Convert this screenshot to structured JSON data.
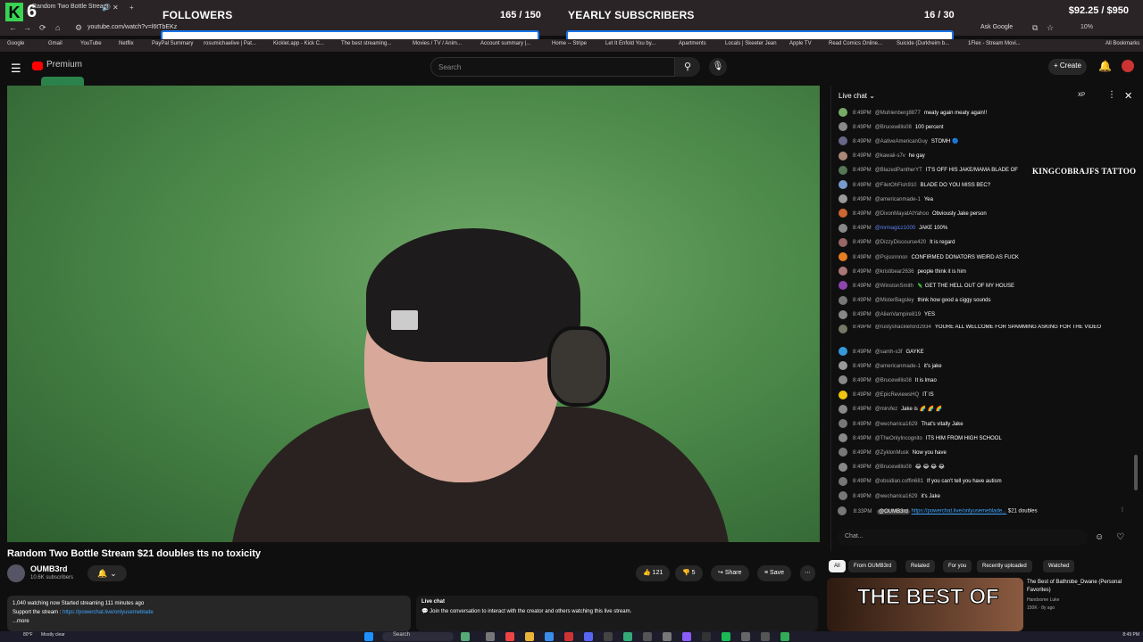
{
  "overlay": {
    "logo_letter": "K",
    "big_number": "6",
    "followers_label": "FOLLOWERS",
    "followers_count": "165 / 150",
    "subs_label": "YEARLY SUBSCRIBERS",
    "subs_count": "16 / 30",
    "money": "$92.25 / $950",
    "kingcobra_text": "KINGCOBRAJFS TATTOO"
  },
  "browser": {
    "tab_title": "Random Two Bottle Stream",
    "url": "youtube.com/watch?v=l6tTbEKz",
    "ask_google": "Ask Google",
    "zoom": "10%",
    "bookmarks": [
      "Google",
      "Gmail",
      "YouTube",
      "Netflix",
      "PayPal Summary",
      "rosumichaelive | Pat...",
      "Kicklet.app - Kick C...",
      "The best streaming...",
      "Movies / TV / Anim...",
      "Account summary |...",
      "Home -- Stripe",
      "Let It Enfold You by...",
      "Apartments",
      "Locals | Skeeter Jean",
      "Apple TV",
      "Read Comics Online...",
      "Suicide (Durkheim b...",
      "1Flex - Stream Movi...",
      "All Bookmarks"
    ]
  },
  "youtube": {
    "premium_label": "Premium",
    "search_placeholder": "Search",
    "create_label": "Create"
  },
  "video": {
    "title": "Random Two Bottle Stream $21 doubles tts no toxicity",
    "channel": "OUMB3rd",
    "subscribers": "10.6K subscribers",
    "likes": "121",
    "dislikes": "5",
    "share": "Share",
    "save": "Save",
    "watching": "1,040 watching now  Started streaming 111 minutes ago",
    "support": "Support the stream :",
    "support_link": "https://powerchat.live/onlyusemeblade",
    "more": "...more",
    "live_chat_title": "Live chat",
    "live_chat_desc": "Join the conversation to interact with the creator and others watching this live stream."
  },
  "chat": {
    "header": "Live chat",
    "xp": "XP",
    "messages": [
      {
        "time": "8:49PM",
        "author": "@Muhlenberg8877",
        "text": "meaty again meaty again!!",
        "color": "#7a6"
      },
      {
        "time": "8:49PM",
        "author": "@Brucewillis08",
        "text": "100 percent",
        "color": "#888"
      },
      {
        "time": "8:49PM",
        "author": "@AativeAmericanGuy",
        "text": "STOMH 🔵",
        "color": "#668"
      },
      {
        "time": "8:49PM",
        "author": "@kawaii-s7v",
        "text": "he gay",
        "color": "#a87"
      },
      {
        "time": "8:49PM",
        "author": "@BlazedPantherYT",
        "text": "IT'S OFF HIS JAKE/MAMA BLADE OF",
        "color": "#575"
      },
      {
        "time": "8:49PM",
        "author": "@FiletOhFish910",
        "text": "BLADE DO YOU MISS BEC?",
        "color": "#79c"
      },
      {
        "time": "8:49PM",
        "author": "@americanmade-1",
        "text": "Yea",
        "color": "#999"
      },
      {
        "time": "8:49PM",
        "author": "@DixonMayatAtYahoo",
        "text": "Obviously Jake person",
        "color": "#c63"
      },
      {
        "time": "8:49PM",
        "author": "@mrmagicz1000",
        "text": "JAKE 100%",
        "color": "#888",
        "highlight": true
      },
      {
        "time": "8:49PM",
        "author": "@DizzyDiscourse420",
        "text": "It is regard",
        "color": "#966"
      },
      {
        "time": "8:49PM",
        "author": "@Psjssnnnsn",
        "text": "CONFIRMED DONATORS WEIRD AS FUCK",
        "color": "#e67e22"
      },
      {
        "time": "8:49PM",
        "author": "@kristibear2636",
        "text": "people think it is him",
        "color": "#a77"
      },
      {
        "time": "8:49PM",
        "author": "@WinstonSmith",
        "text": "🦎 GET THE HELL OUT OF MY HOUSE",
        "color": "#8e44ad"
      },
      {
        "time": "8:49PM",
        "author": "@MisterBagsley",
        "text": "think how good a ciggy sounds",
        "color": "#777"
      },
      {
        "time": "8:49PM",
        "author": "@AlienVampire819",
        "text": "YES",
        "color": "#888"
      },
      {
        "time": "8:49PM",
        "author": "@rustyshackleford2934",
        "text": "YOURE ALL WELCOME FOR SPAMMING ASKING FOR THE VIDEO",
        "color": "#776",
        "wrap": true
      },
      {
        "time": "8:49PM",
        "author": "@samh-s3f",
        "text": "GAYKE",
        "color": "#3498db"
      },
      {
        "time": "8:49PM",
        "author": "@americanmade-1",
        "text": "it's jake",
        "color": "#999"
      },
      {
        "time": "8:49PM",
        "author": "@Brucewillis08",
        "text": "It is lmao",
        "color": "#888"
      },
      {
        "time": "8:49PM",
        "author": "@EpicReviewsHQ",
        "text": "IT IS",
        "color": "#f1c40f"
      },
      {
        "time": "8:49PM",
        "author": "@mirvfez",
        "text": "Jake is 🌈 🌈 🌈",
        "color": "#888"
      },
      {
        "time": "8:49PM",
        "author": "@wechanica1629",
        "text": "That's vitally Jake",
        "color": "#777"
      },
      {
        "time": "8:49PM",
        "author": "@TheOnlyIncognito",
        "text": "ITS HIM FROM HIGH SCHOOL",
        "color": "#888"
      },
      {
        "time": "8:49PM",
        "author": "@ZyklonMusk",
        "text": "Now you have",
        "color": "#777"
      },
      {
        "time": "8:49PM",
        "author": "@Brucewillis08",
        "text": "😂 😂 😂 😂",
        "color": "#888"
      },
      {
        "time": "8:49PM",
        "author": "@obsidian.coffin681",
        "text": "If you can't tell you have autism",
        "color": "#777"
      },
      {
        "time": "8:49PM",
        "author": "@wechanica1629",
        "text": "it's Jake",
        "color": "#777"
      }
    ],
    "pinned": {
      "time": "8:33PM",
      "author": "@OUMB3rd",
      "link": "https://powerchat.live/onlyusemeblade...",
      "text": "$21 doubles"
    },
    "input_placeholder": "Chat..."
  },
  "related": {
    "chips": [
      "All",
      "From OUMB3rd",
      "Related",
      "For you",
      "Recently uploaded",
      "Watched"
    ],
    "thumb_text": "THE BEST OF",
    "title": "The Best of Bathrobe_Dwane (Personal Favorites)",
    "channel": "Handsome Luke",
    "meta": "150K · 8y ago"
  },
  "taskbar": {
    "weather": "80°F",
    "weather_sub": "Mostly clear",
    "search": "Search",
    "clock": "8:49 PM"
  },
  "colors": {
    "accent_link": "#3ea6ff",
    "overlay_green": "#39d353",
    "youtube_red": "#ff0000"
  }
}
